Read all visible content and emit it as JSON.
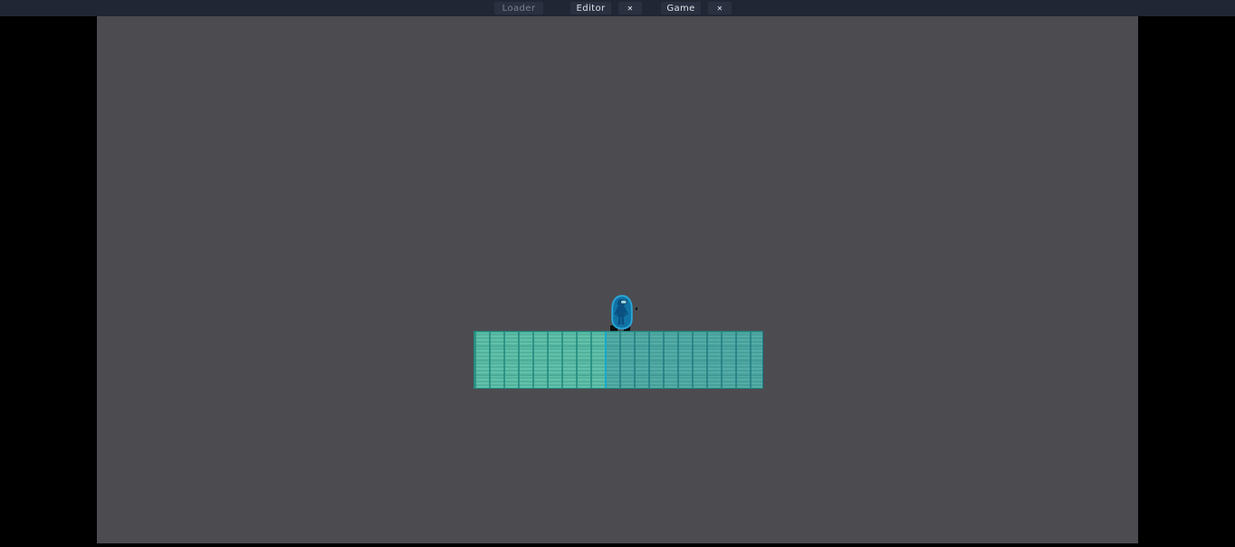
{
  "tabbar": {
    "tabs": [
      {
        "label": "Loader",
        "state": "inactive"
      },
      {
        "label": "Editor",
        "state": "active"
      },
      {
        "label": "Game",
        "state": "active"
      }
    ],
    "close_label": "✕"
  },
  "scene": {
    "platform": {
      "tile_columns": 20,
      "tile_rows": 4,
      "tile_size_px": 16,
      "tile_color": "#57b7a0",
      "tile_stripe_color": "#61c2ac",
      "grid_line_color": "#2f9a8c",
      "border_color": "#23877e",
      "selection_line_color": "#17a9cc",
      "selected_columns": 11
    },
    "player": {
      "type": "bubble-suit-character",
      "bubble_outline_color": "#2aa9da",
      "bubble_fill_color": "#1173a5",
      "body_color": "#0b5080",
      "visor_color": "#a8dcee",
      "feet_color": "#0a0d0e"
    }
  },
  "colors": {
    "tabbar_bg": "#212634",
    "tab_bg": "#2a3040",
    "tab_text_active": "#dfe3ea",
    "tab_text_inactive": "#78808f",
    "viewport_bg": "#4c4c50",
    "letterbox_bg": "#000000"
  }
}
